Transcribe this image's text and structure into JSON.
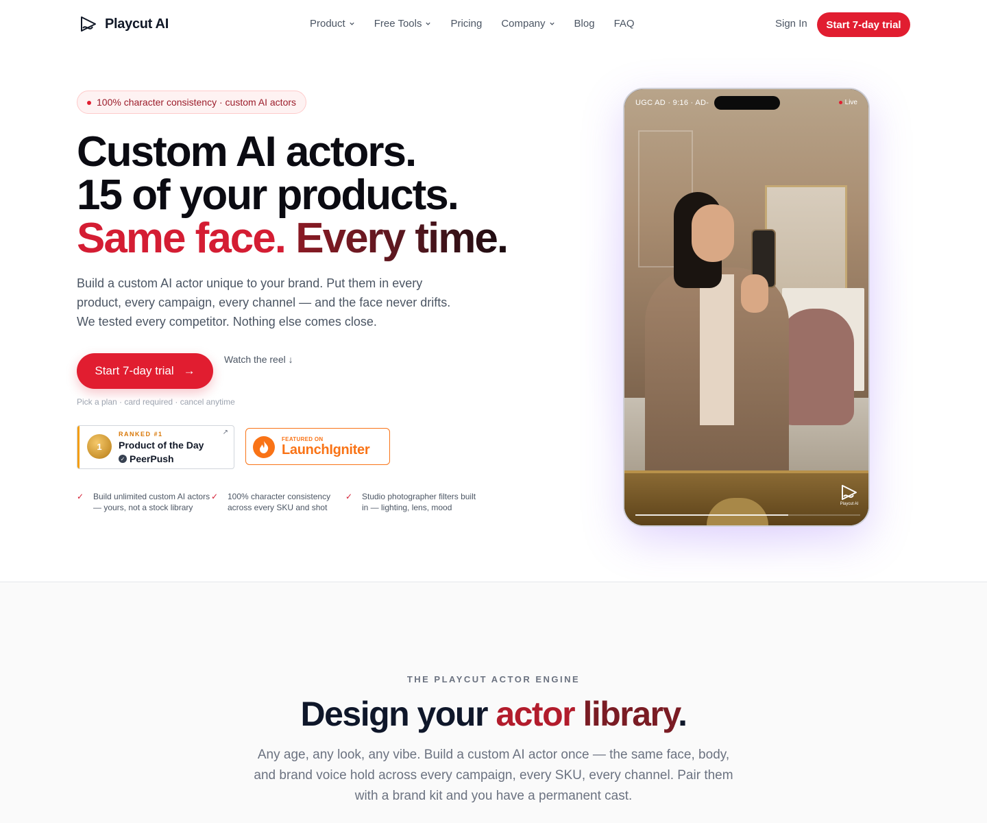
{
  "nav": {
    "brand": "Playcut AI",
    "menu": [
      "Product",
      "Free Tools",
      "Pricing",
      "Company",
      "Blog",
      "FAQ"
    ],
    "sign_in": "Sign In",
    "cta": "Start 7-day trial"
  },
  "hero": {
    "pill": "100% character consistency · custom AI actors",
    "h1_line1": "Custom AI actors.",
    "h1_line2": "15 of your products.",
    "h1_line3_a": "Same face.",
    "h1_line3_b": "Every time.",
    "lead": "Build a custom AI actor unique to your brand. Put them in every product, every campaign, every channel — and the face never drifts. We tested every competitor. Nothing else comes close.",
    "cta": "Start 7-day trial",
    "cta_arrow": "→",
    "watch": "Watch the reel ↓",
    "note": "Pick a plan · card required · cancel anytime",
    "badge_peerpush": {
      "ranked": "RANKED #1",
      "title": "Product of the Day",
      "brand": "PeerPush",
      "medal": "1"
    },
    "badge_launchigniter": {
      "featured": "FEATURED ON",
      "brand": "LaunchIgniter"
    },
    "checks": [
      "Build unlimited custom AI actors — yours, not a stock library",
      "100% character consistency across every SKU and shot",
      "Studio photographer filters built in — lighting, lens, mood"
    ],
    "check_icon": "✓"
  },
  "phone": {
    "topbar": "UGC AD · 9:16 · AD-",
    "live": "Live",
    "watermark": "Playcut AI",
    "progress": 0.68
  },
  "section2": {
    "eyebrow": "THE PLAYCUT ACTOR ENGINE",
    "h2_a": "Design your ",
    "h2_b": "actor",
    "h2_c": " library",
    "h2_d": ".",
    "sub": "Any age, any look, any vibe. Build a custom AI actor once — the same face, body, and brand voice hold across every campaign, every SKU, every channel. Pair them with a brand kit and you have a permanent cast."
  },
  "colors": {
    "accent": "#e11d30",
    "brand_dark": "#7a1c24",
    "launchigniter": "#f97316",
    "peerpush": "#f59e0b"
  }
}
